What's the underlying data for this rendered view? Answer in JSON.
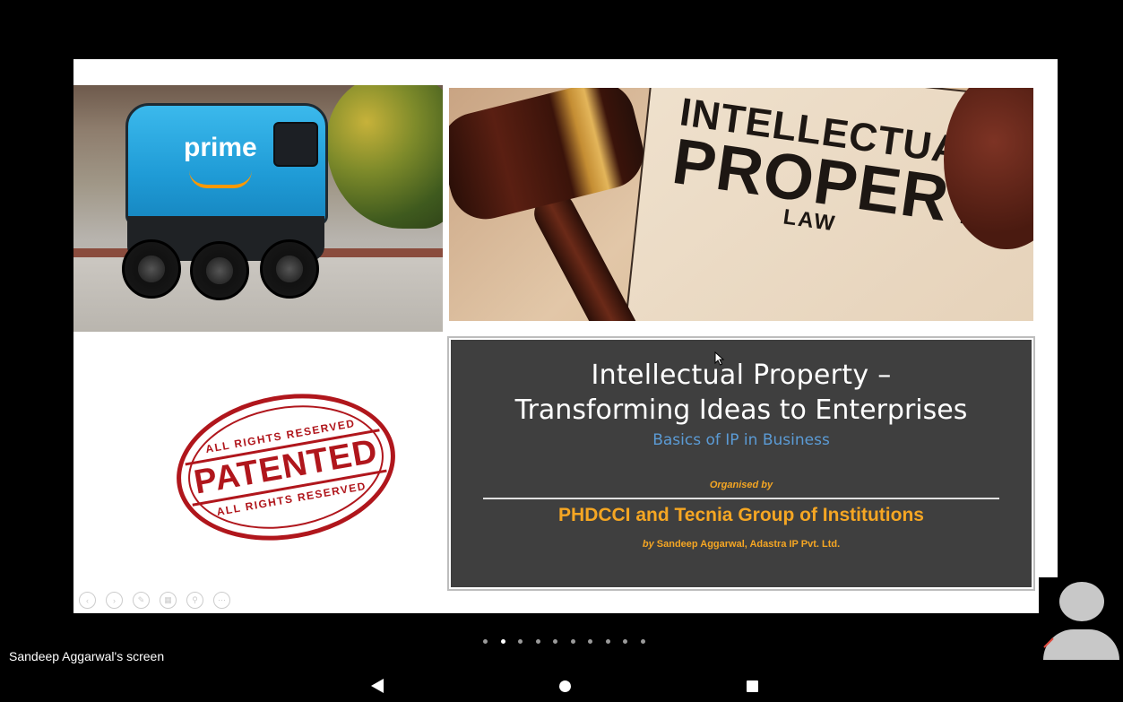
{
  "slide": {
    "robot_logo": "prime",
    "stamp": {
      "ring_top": "ALL RIGHTS RESERVED",
      "word": "PATENTED",
      "ring_bottom": "ALL RIGHTS RESERVED"
    },
    "law_photo": {
      "line1": "INTELLECTUAL",
      "line2": "PROPERTY",
      "line3": "LAW"
    },
    "title_box": {
      "title_line1": "Intellectual Property –",
      "title_line2": "Transforming Ideas to Enterprises",
      "subtitle": "Basics of IP in Business",
      "organised_by": "Organised by",
      "organisers": "PHDCCI and Tecnia Group of Institutions",
      "by_prefix": "by",
      "byline": "Sandeep Aggarwal, Adastra IP Pvt. Ltd."
    },
    "controls": [
      {
        "name": "previous-slide",
        "glyph": "‹"
      },
      {
        "name": "next-slide",
        "glyph": "›"
      },
      {
        "name": "pen",
        "glyph": "✎"
      },
      {
        "name": "see-all-slides",
        "glyph": "▦"
      },
      {
        "name": "zoom",
        "glyph": "⚲"
      },
      {
        "name": "more-options",
        "glyph": "⋯"
      }
    ]
  },
  "screen_share_label": "Sandeep Aggarwal's screen",
  "pager": {
    "total": 10,
    "active_index": 1
  },
  "colors": {
    "title_box_bg": "#3f3f3f",
    "subtitle": "#5b9bd5",
    "accent_orange": "#f5a623",
    "stamp_red": "#b0161c"
  }
}
